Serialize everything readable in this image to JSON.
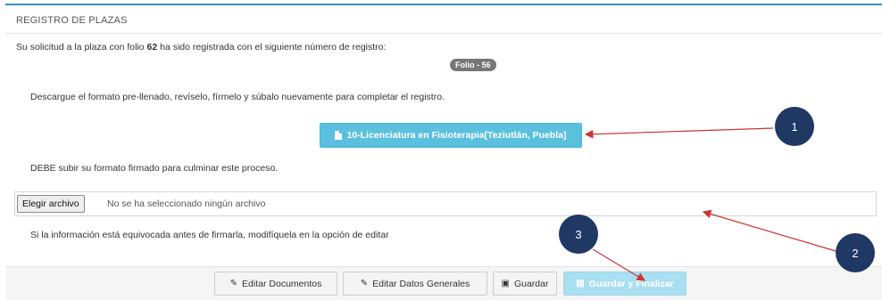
{
  "panel": {
    "title": "REGISTRO DE PLAZAS"
  },
  "messages": {
    "line1_prefix": "Su solicitud a la plaza con folio",
    "folio_number": "62",
    "line1_suffix": "ha sido registrada con el siguiente número de registro:",
    "badge": "Folio - 56",
    "download_instructions": "Descargue el formato pre-llenado, revíselo, fírmelo y súbalo nuevamente para completar el registro.",
    "must_upload": "DEBE subir su formato firmado para culminar este proceso.",
    "wrong_info": "Si la información está equivocada antes de firmarla, modifíquela en la opción de editar"
  },
  "download_button": {
    "label": "10-Licenciatura en Fisioterapia[Teziutlán, Puebla]",
    "icon": "file-icon"
  },
  "file_input": {
    "button_label": "Elegir archivo",
    "status": "No se ha seleccionado ningún archivo"
  },
  "footer": {
    "edit_documents": "Editar Documentos",
    "edit_general": "Editar Datos Generales",
    "save": "Guardar",
    "save_finalize": "Guardar y Finalizar"
  },
  "markers": [
    "1",
    "2",
    "3"
  ],
  "colors": {
    "accent": "#3c8dbc",
    "info": "#5bc0de",
    "marker": "#1f3864",
    "arrow": "#cc3333"
  }
}
